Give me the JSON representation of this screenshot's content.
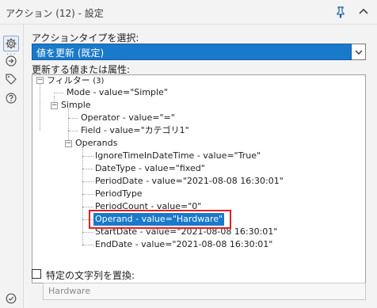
{
  "window": {
    "title": "アクション (12) - 設定"
  },
  "icons": {
    "pin": "pin-icon",
    "collapse": "chevron-up-icon",
    "settings": "gear-icon",
    "connect": "arrow-circle-icon",
    "tag": "tag-icon",
    "help": "help-icon",
    "status": "check-circle-icon"
  },
  "action": {
    "label": "アクションタイプを選択:",
    "selected": "値を更新 (既定)"
  },
  "fields": {
    "label": "更新する値または属性:",
    "tree": [
      {
        "label": "フィルター",
        "count": "(3)"
      },
      {
        "label": "Mode - value=\"Simple\""
      },
      {
        "label": "Simple"
      },
      {
        "label": "Operator - value=\"=\""
      },
      {
        "label": "Field - value=\"カテゴリ1\""
      },
      {
        "label": "Operands"
      },
      {
        "label": "IgnoreTimeInDateTime - value=\"True\""
      },
      {
        "label": "DateType - value=\"fixed\""
      },
      {
        "label": "PeriodDate - value=\"2021-08-08 16:30:01\""
      },
      {
        "label": "PeriodType"
      },
      {
        "label": "PeriodCount - value=\"0\""
      },
      {
        "label": "Operand - value=\"Hardware\""
      },
      {
        "label": "StartDate - value=\"2021-08-08 16:30:01\""
      },
      {
        "label": "EndDate - value=\"2021-08-08 16:30:01\""
      }
    ]
  },
  "replace": {
    "label": "特定の文字列を置換:",
    "checked": false,
    "value": "Hardware"
  },
  "colors": {
    "accent": "#1979ca",
    "highlight": "#e02020"
  }
}
